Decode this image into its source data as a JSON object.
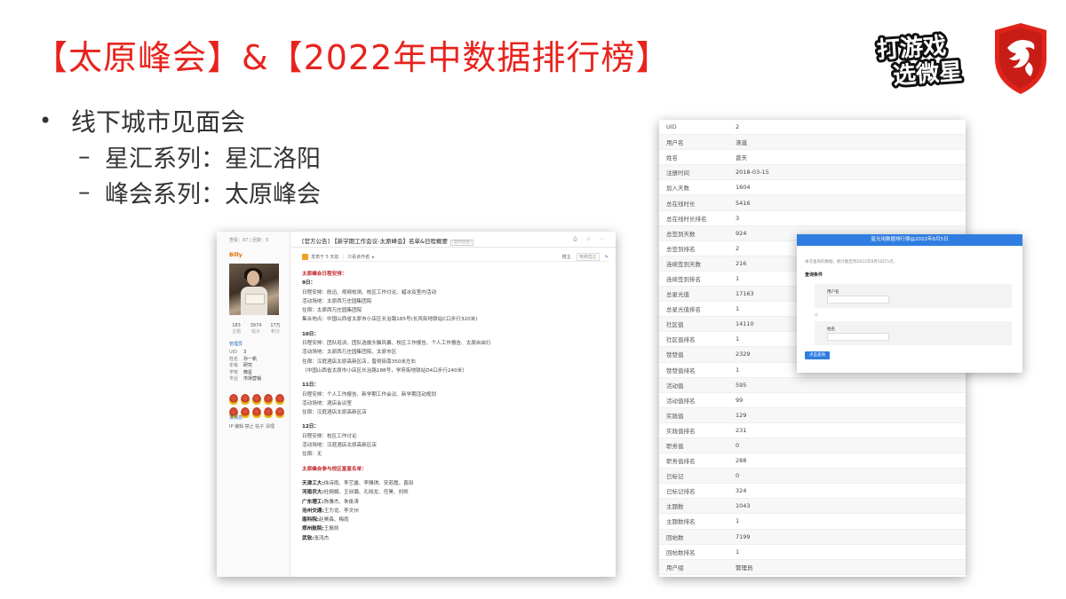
{
  "slide": {
    "title": "【太原峰会】&【2022年中数据排行榜】",
    "logo_slogan_line1": "打游戏",
    "logo_slogan_line2": "选微星",
    "bullets": {
      "main": "线下城市见面会",
      "sub1": "星汇系列：星汇洛阳",
      "sub2": "峰会系列：太原峰会"
    },
    "colors": {
      "title": "#e8231d",
      "accent_blue": "#2f7de1",
      "forum_red": "#c0272d"
    }
  },
  "forum": {
    "stats_top": "查看：97 | 回复：5",
    "username": "Billy",
    "stats": [
      {
        "value": "183",
        "label": "主题"
      },
      {
        "value": "3974",
        "label": "帖子"
      },
      {
        "value": "17万",
        "label": "积分"
      }
    ],
    "role": "管理员",
    "profile": [
      {
        "k": "UID",
        "v": "3"
      },
      {
        "k": "姓名",
        "v": "孙一帆"
      },
      {
        "k": "年级",
        "v": "研究"
      },
      {
        "k": "学校",
        "v": "微星"
      },
      {
        "k": "专业",
        "v": "市场营销"
      }
    ],
    "fans": "发消息",
    "actions": "IP 编辑 禁止 帖子 清理",
    "post_title": "[官方公告] 【新学期工作会议-太原峰会】名单&日程概要",
    "post_tag": "[复制链接]",
    "head_icons": "⎙ ☆ ⋯",
    "meta_author": "发表于 5 天前",
    "meta_only": "只看该作者",
    "meta_arrow": "▸",
    "meta_right1": "楼主",
    "meta_right2": "电梯直达",
    "pen_icon": "✎",
    "body": {
      "heading1": "太原峰会日程安排：",
      "d9": "9日：",
      "d9_1": "日程安排：航迅、视频校测、校区工作讨论、蜡冰及室内活动",
      "d9_2": "活动场地：太原西万庄园集团院",
      "d9_3": "住宿：太原西万庄园集团院",
      "d9_4": "集合地点：中国山西省太原市小店区长治路185号(长风街地铁站C口步行320米)",
      "d10": "10日：",
      "d10_1": "日程安排：团队培训、团队选拔头脑风暴、校区工作报告、个人工作报告、太原自由行",
      "d10_2": "活动场地：太原西万庄园集团院、太原市区",
      "d10_3": "住宿：汉庭酒店太原高新区店，晋祠街南350米左右",
      "d10_4": "（中国山西省太原市小店区长治路188号，学府街地铁站D4口步行240米）",
      "d11": "11日：",
      "d11_1": "日程安排：个人工作报告、新学期工作会议、新学期活动规划",
      "d11_2": "活动场地：酒店会议室",
      "d11_3": "住宿：汉庭酒店太原高新区店",
      "d12": "12日：",
      "d12_1": "日程安排：校区工作讨论",
      "d12_2": "活动场地：汉庭酒店太原高新区店",
      "d12_3": "住宿：无",
      "heading2": "太原峰会参与校区星星名单：",
      "schools": [
        {
          "name": "天津工大:",
          "people": "徐诗雨、李艺露、李雅琪、安若霞、喜田"
        },
        {
          "name": "河南农大:",
          "people": "杜婉娟、王欣璐、孔晓龙、任昊、刘凯"
        },
        {
          "name": "广东理工:",
          "people": "陈雅杰、朱俊涛"
        },
        {
          "name": "沧州交通:",
          "people": "王力龙、李文州"
        },
        {
          "name": "南科院:",
          "people": "赵昊森、梅雨"
        },
        {
          "name": "郑州航院:",
          "people": "王振凯"
        },
        {
          "name": "武软:",
          "people": "张鸿杰"
        }
      ]
    }
  },
  "uid_table": {
    "rows": [
      {
        "k": "UID",
        "v": "2"
      },
      {
        "k": "用户名",
        "v": "涤涎"
      },
      {
        "k": "姓名",
        "v": "曾天"
      },
      {
        "k": "注册时间",
        "v": "2018-03-15"
      },
      {
        "k": "加入天数",
        "v": "1604"
      },
      {
        "k": "总在线时长",
        "v": "5416"
      },
      {
        "k": "总在线时长排名",
        "v": "3"
      },
      {
        "k": "总签到天数",
        "v": "924"
      },
      {
        "k": "总签到排名",
        "v": "2"
      },
      {
        "k": "连续签到天数",
        "v": "216"
      },
      {
        "k": "连续签到排名",
        "v": "1"
      },
      {
        "k": "总星光值",
        "v": "17163"
      },
      {
        "k": "总星光值排名",
        "v": "1"
      },
      {
        "k": "社区值",
        "v": "14110"
      },
      {
        "k": "社区值排名",
        "v": "1"
      },
      {
        "k": "赞赞值",
        "v": "2329"
      },
      {
        "k": "赞赞值排名",
        "v": "1"
      },
      {
        "k": "活动值",
        "v": "595"
      },
      {
        "k": "活动值排名",
        "v": "99"
      },
      {
        "k": "实践值",
        "v": "129"
      },
      {
        "k": "实践值排名",
        "v": "231"
      },
      {
        "k": "职务值",
        "v": "0"
      },
      {
        "k": "职务值排名",
        "v": "288"
      },
      {
        "k": "已标记",
        "v": "0"
      },
      {
        "k": "已标记排名",
        "v": "324"
      },
      {
        "k": "主题数",
        "v": "1043"
      },
      {
        "k": "主题数排名",
        "v": "1"
      },
      {
        "k": "回帖数",
        "v": "7199"
      },
      {
        "k": "回帖数排名",
        "v": "1"
      },
      {
        "k": "用户组",
        "v": "管理员"
      }
    ]
  },
  "query": {
    "header": "星光用数据排行榜@2022年8月5日",
    "note": "本次查询的数据，统计截至到2022年8月5日15点。",
    "condition": "查询条件",
    "label_user": "用户名",
    "label_name": "姓名",
    "or": "或",
    "button": "点击查询"
  }
}
